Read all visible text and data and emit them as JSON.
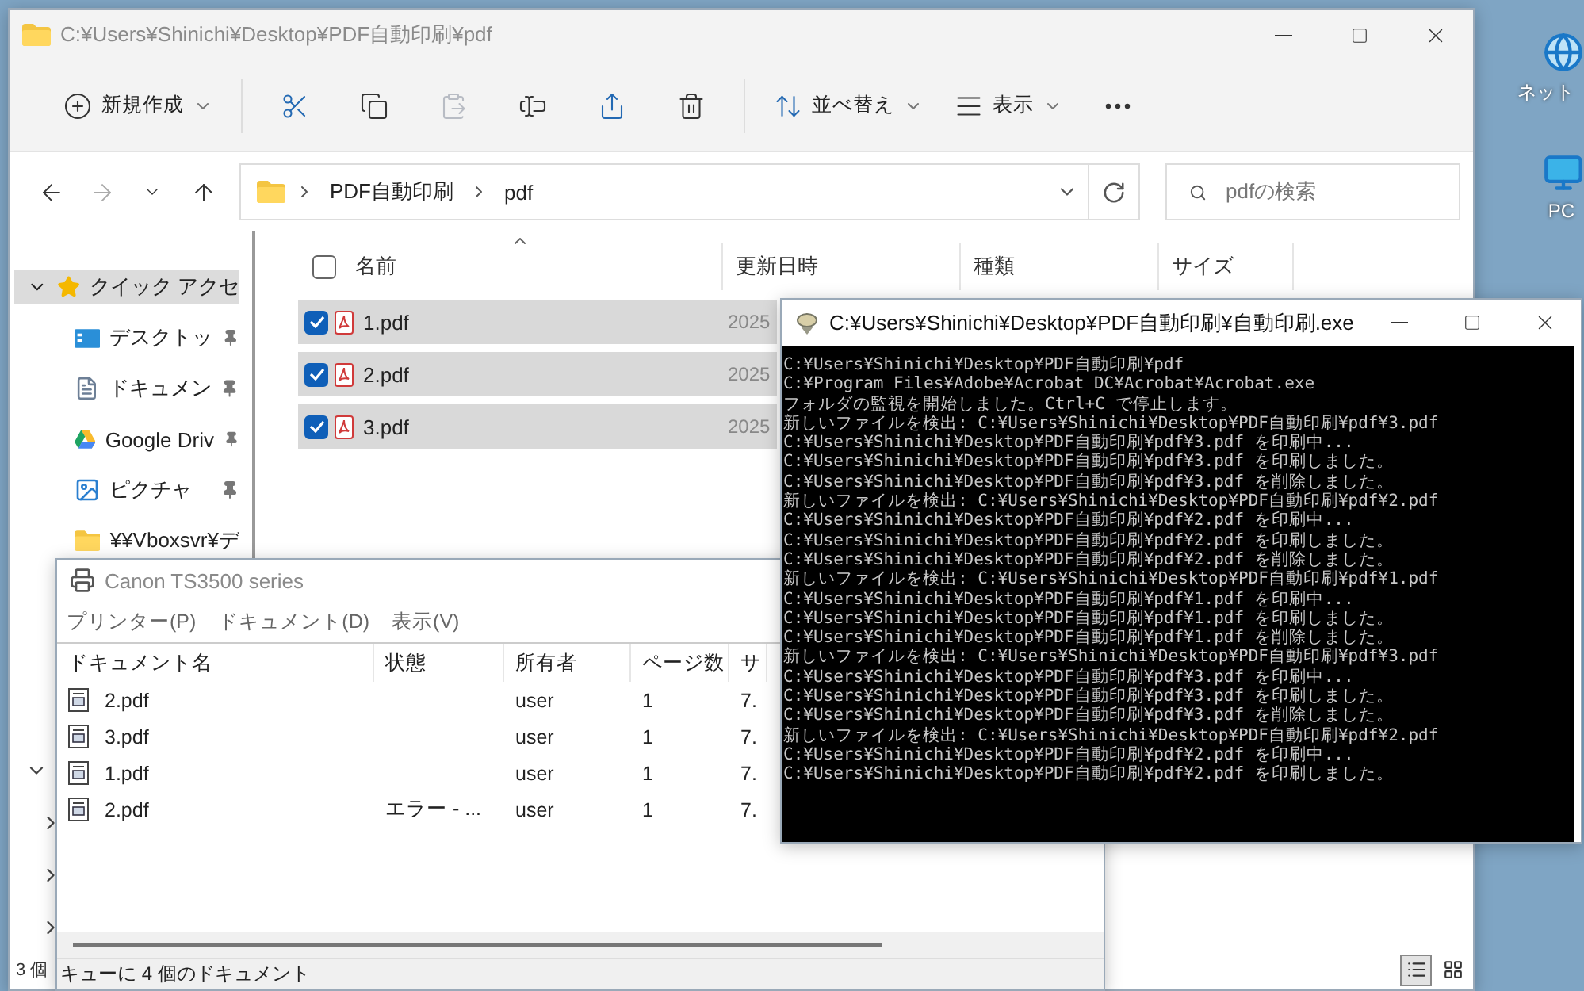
{
  "desktop_icons": [
    {
      "kind": "network",
      "label": "ネット"
    },
    {
      "kind": "pc",
      "label": "PC"
    }
  ],
  "explorer": {
    "title": "C:¥Users¥Shinichi¥Desktop¥PDF自動印刷¥pdf",
    "toolbar_groups": [
      {
        "items": [
          {
            "kind": "new",
            "label": "新規作成",
            "dropdown": true,
            "disabled": false
          }
        ]
      },
      {
        "items": [
          {
            "kind": "cut",
            "disabled": false
          },
          {
            "kind": "copy",
            "disabled": false
          },
          {
            "kind": "paste",
            "disabled": true
          },
          {
            "kind": "rename",
            "disabled": false
          },
          {
            "kind": "share",
            "disabled": false
          },
          {
            "kind": "delete",
            "disabled": false
          }
        ]
      },
      {
        "items": [
          {
            "kind": "sort",
            "label": "並べ替え",
            "dropdown": true,
            "disabled": false
          },
          {
            "kind": "view",
            "label": "表示",
            "dropdown": true,
            "disabled": false
          },
          {
            "kind": "more",
            "disabled": false
          }
        ]
      }
    ],
    "nav": [
      {
        "kind": "back",
        "disabled": false
      },
      {
        "kind": "forward",
        "disabled": true
      },
      {
        "kind": "recent",
        "disabled": false
      },
      {
        "kind": "up",
        "disabled": false
      }
    ],
    "address": {
      "segments": [
        "PDF自動印刷",
        "pdf"
      ]
    },
    "search": {
      "placeholder": "pdfの検索"
    },
    "sidebar": {
      "items": [
        {
          "kind": "quick",
          "label": "クイック アクセ",
          "expanded": true,
          "pinned": false,
          "selected": true
        },
        {
          "kind": "desktop",
          "label": "デスクトッ",
          "pinned": true,
          "selected": false
        },
        {
          "kind": "documents",
          "label": "ドキュメン",
          "pinned": true,
          "selected": false
        },
        {
          "kind": "gdrive",
          "label": "Google Driv",
          "pinned": true,
          "selected": false
        },
        {
          "kind": "pictures",
          "label": "ピクチャ",
          "pinned": true,
          "selected": false
        },
        {
          "kind": "folder",
          "label": "¥¥Vboxsvr¥デ",
          "pinned": false,
          "selected": false
        }
      ],
      "tree": [
        {
          "expanded": true,
          "children": [
            {
              "expanded": false
            },
            {
              "expanded": false
            },
            {
              "expanded": false
            }
          ]
        }
      ]
    },
    "select_all": {
      "checked": false
    },
    "columns": [
      {
        "label": "名前",
        "sorted": true
      },
      {
        "label": "更新日時",
        "sorted": false
      },
      {
        "label": "種類",
        "sorted": false
      },
      {
        "label": "サイズ",
        "sorted": false
      }
    ],
    "files": [
      {
        "name": "1.pdf",
        "modified": "2025",
        "checked": true,
        "selected": true
      },
      {
        "name": "2.pdf",
        "modified": "2025",
        "checked": true,
        "selected": true
      },
      {
        "name": "3.pdf",
        "modified": "2025",
        "checked": true,
        "selected": true
      }
    ],
    "status": "3 個",
    "view_buttons": [
      {
        "kind": "details",
        "selected": true
      },
      {
        "kind": "tiles",
        "selected": false
      }
    ]
  },
  "printer_queue": {
    "title": "Canon TS3500 series",
    "menu": [
      "プリンター(P)",
      "ドキュメント(D)",
      "表示(V)"
    ],
    "columns": [
      "ドキュメント名",
      "状態",
      "所有者",
      "ページ数",
      "サ"
    ],
    "jobs": [
      {
        "name": "2.pdf",
        "owner": "user",
        "pages": "1",
        "size": "7."
      },
      {
        "name": "3.pdf",
        "owner": "user",
        "pages": "1",
        "size": "7."
      },
      {
        "name": "1.pdf",
        "owner": "user",
        "pages": "1",
        "size": "7."
      },
      {
        "name": "2.pdf",
        "status": "エラー - ...",
        "owner": "user",
        "pages": "1",
        "size": "7."
      }
    ],
    "status": "キューに 4 個のドキュメント"
  },
  "console": {
    "title": "C:¥Users¥Shinichi¥Desktop¥PDF自動印刷¥自動印刷.exe",
    "lines": [
      "C:¥Users¥Shinichi¥Desktop¥PDF自動印刷¥pdf",
      "C:¥Program Files¥Adobe¥Acrobat DC¥Acrobat¥Acrobat.exe",
      "フォルダの監視を開始しました。Ctrl+C で停止します。",
      "新しいファイルを検出: C:¥Users¥Shinichi¥Desktop¥PDF自動印刷¥pdf¥3.pdf",
      "C:¥Users¥Shinichi¥Desktop¥PDF自動印刷¥pdf¥3.pdf を印刷中...",
      "C:¥Users¥Shinichi¥Desktop¥PDF自動印刷¥pdf¥3.pdf を印刷しました。",
      "C:¥Users¥Shinichi¥Desktop¥PDF自動印刷¥pdf¥3.pdf を削除しました。",
      "新しいファイルを検出: C:¥Users¥Shinichi¥Desktop¥PDF自動印刷¥pdf¥2.pdf",
      "C:¥Users¥Shinichi¥Desktop¥PDF自動印刷¥pdf¥2.pdf を印刷中...",
      "C:¥Users¥Shinichi¥Desktop¥PDF自動印刷¥pdf¥2.pdf を印刷しました。",
      "C:¥Users¥Shinichi¥Desktop¥PDF自動印刷¥pdf¥2.pdf を削除しました。",
      "新しいファイルを検出: C:¥Users¥Shinichi¥Desktop¥PDF自動印刷¥pdf¥1.pdf",
      "C:¥Users¥Shinichi¥Desktop¥PDF自動印刷¥pdf¥1.pdf を印刷中...",
      "C:¥Users¥Shinichi¥Desktop¥PDF自動印刷¥pdf¥1.pdf を印刷しました。",
      "C:¥Users¥Shinichi¥Desktop¥PDF自動印刷¥pdf¥1.pdf を削除しました。",
      "新しいファイルを検出: C:¥Users¥Shinichi¥Desktop¥PDF自動印刷¥pdf¥3.pdf",
      "C:¥Users¥Shinichi¥Desktop¥PDF自動印刷¥pdf¥3.pdf を印刷中...",
      "C:¥Users¥Shinichi¥Desktop¥PDF自動印刷¥pdf¥3.pdf を印刷しました。",
      "C:¥Users¥Shinichi¥Desktop¥PDF自動印刷¥pdf¥3.pdf を削除しました。",
      "新しいファイルを検出: C:¥Users¥Shinichi¥Desktop¥PDF自動印刷¥pdf¥2.pdf",
      "C:¥Users¥Shinichi¥Desktop¥PDF自動印刷¥pdf¥2.pdf を印刷中...",
      "C:¥Users¥Shinichi¥Desktop¥PDF自動印刷¥pdf¥2.pdf を印刷しました。"
    ]
  }
}
